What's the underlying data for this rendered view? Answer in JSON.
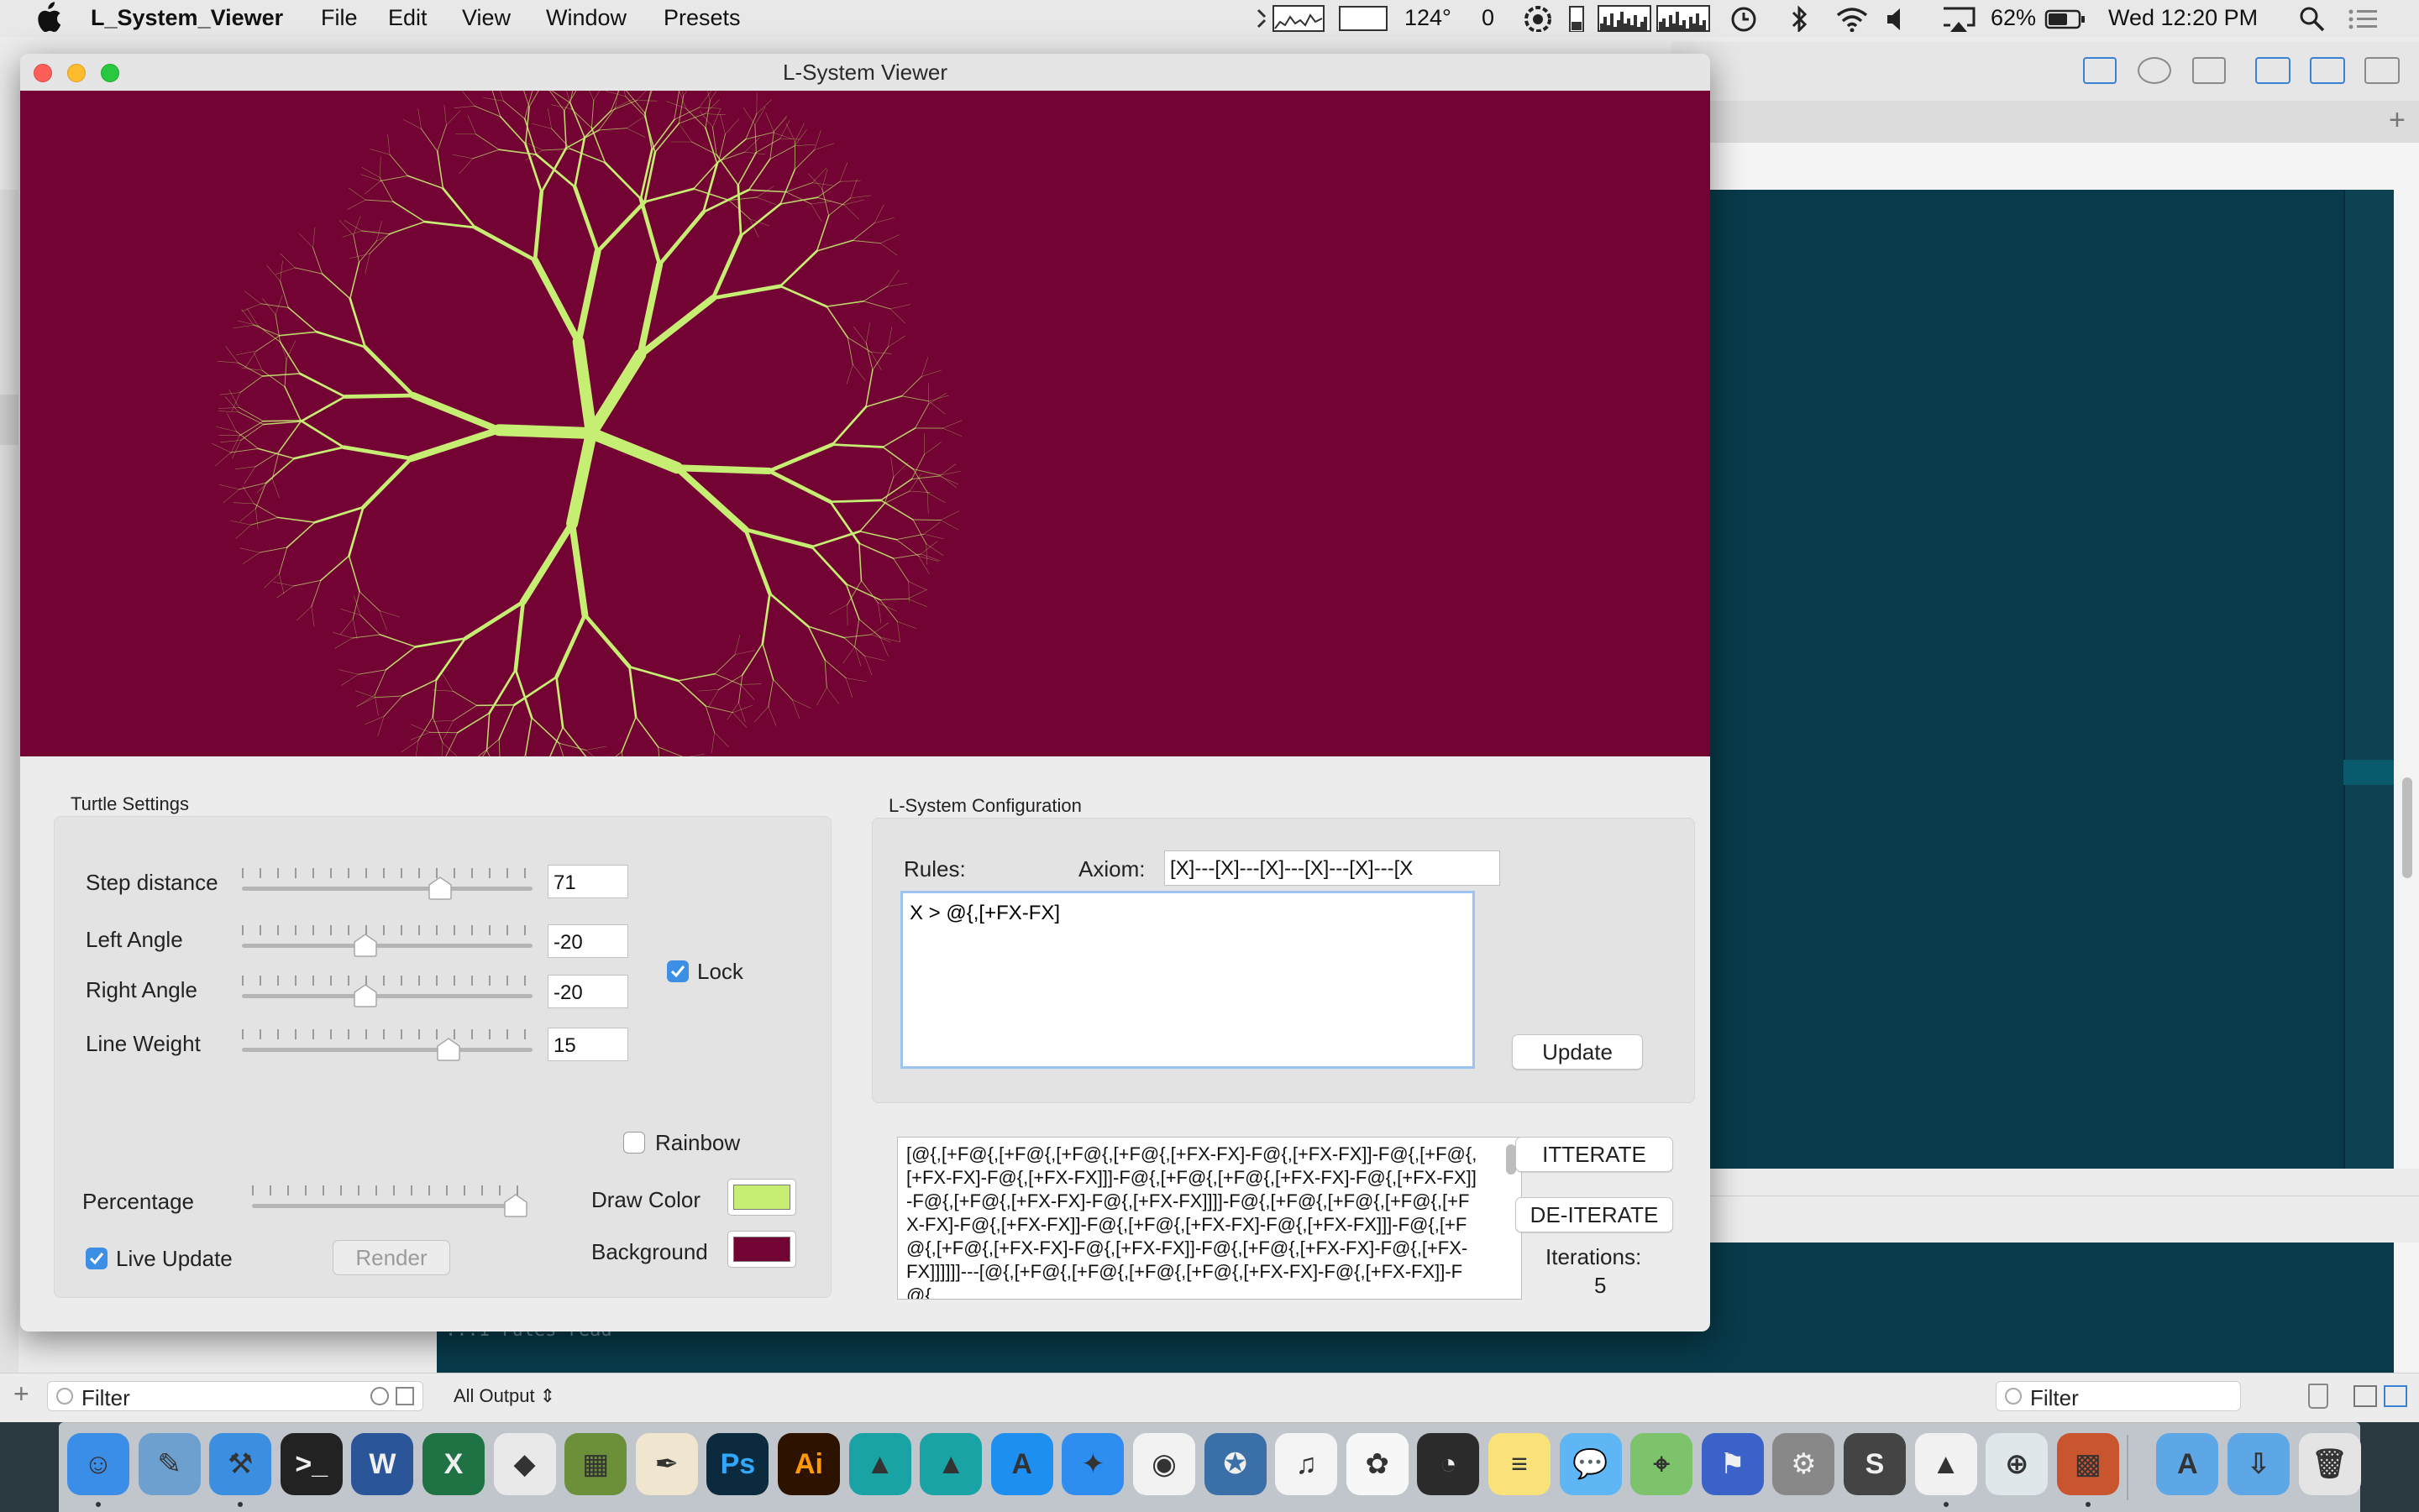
{
  "menubar": {
    "app_name": "L_System_Viewer",
    "menus": [
      "File",
      "Edit",
      "View",
      "Window",
      "Presets"
    ],
    "status": {
      "temperature": "124°",
      "counter": "0",
      "battery": "62%",
      "clock": "Wed 12:20 PM"
    }
  },
  "window": {
    "title": "L-System Viewer",
    "canvas_background": "#720333",
    "plant_color": "#c6ee72"
  },
  "turtle": {
    "group_title": "Turtle Settings",
    "step_label": "Step distance",
    "step_value": "71",
    "left_label": "Left Angle",
    "left_value": "-20",
    "right_label": "Right Angle",
    "right_value": "-20",
    "weight_label": "Line Weight",
    "weight_value": "15",
    "lock_label": "Lock",
    "lock_checked": true,
    "rainbow_label": "Rainbow",
    "rainbow_checked": false,
    "percentage_label": "Percentage",
    "draw_color_label": "Draw Color",
    "draw_color": "#c6ee72",
    "background_label": "Background",
    "background_color": "#720333",
    "live_update_label": "Live Update",
    "live_update_checked": true,
    "render_label": "Render",
    "sliders": {
      "step_fraction": 0.69,
      "left_fraction": 0.42,
      "right_fraction": 0.42,
      "weight_fraction": 0.72,
      "percentage_fraction": 1.0
    }
  },
  "lsystem": {
    "group_title": "L-System Configuration",
    "rules_label": "Rules:",
    "axiom_label": "Axiom:",
    "axiom_value": "[X]---[X]---[X]---[X]---[X]---[X",
    "rules_text": "X > @{,[+FX-FX]",
    "update_label": "Update",
    "output_text": "[@{,[+F@{,[+F@{,[+F@{,[+F@{,[+FX-FX]-F@{,[+FX-FX]]-F@{,[+F@{,[+FX-FX]-F@{,[+FX-FX]]]-F@{,[+F@{,[+F@{,[+FX-FX]-F@{,[+FX-FX]]-F@{,[+F@{,[+FX-FX]-F@{,[+FX-FX]]]]-F@{,[+F@{,[+F@{,[+F@{,[+FX-FX]-F@{,[+FX-FX]]-F@{,[+F@{,[+FX-FX]-F@{,[+FX-FX]]]-F@{,[+F@{,[+F@{,[+FX-FX]-F@{,[+FX-FX]]-F@{,[+F@{,[+FX-FX]-F@{,[+FX-FX]]]]]]---[@{,[+F@{,[+F@{,[+F@{,[+F@{,[+FX-FX]-F@{,[+FX-FX]]-F@{,",
    "iterate_label": "ITTERATE",
    "deiterate_label": "DE-ITERATE",
    "iterations_label": "Iterations:",
    "iterations_value": "5"
  },
  "xcode": {
    "console_text": "...1 rules read",
    "all_output_label": "All Output",
    "filter_placeholder_left": "Filter",
    "filter_placeholder_right": "Filter"
  },
  "dock": {
    "apps": [
      {
        "name": "Finder",
        "color": "#3a8ee8",
        "glyph": "☺"
      },
      {
        "name": "Preview",
        "color": "#6ea0cf",
        "glyph": "✎"
      },
      {
        "name": "Xcode",
        "color": "#3c8fe0",
        "glyph": "⚒"
      },
      {
        "name": "Terminal",
        "color": "#222222",
        "glyph": ">_"
      },
      {
        "name": "Word",
        "color": "#2a5699",
        "glyph": "W"
      },
      {
        "name": "Excel",
        "color": "#1f7244",
        "glyph": "X"
      },
      {
        "name": "Unity",
        "color": "#e9e9e9",
        "glyph": "◆"
      },
      {
        "name": "Minecraft",
        "color": "#6c8f3a",
        "glyph": "▦"
      },
      {
        "name": "Pen",
        "color": "#f0e6cf",
        "glyph": "✒"
      },
      {
        "name": "Photoshop",
        "color": "#0c2a3e",
        "glyph": "Ps"
      },
      {
        "name": "Illustrator",
        "color": "#2e1200",
        "glyph": "Ai"
      },
      {
        "name": "Maya",
        "color": "#19a3a5",
        "glyph": "▲"
      },
      {
        "name": "Mudbox",
        "color": "#19a3a5",
        "glyph": "▲"
      },
      {
        "name": "App Store",
        "color": "#1d8ff0",
        "glyph": "A"
      },
      {
        "name": "Safari",
        "color": "#2d8ef0",
        "glyph": "✦"
      },
      {
        "name": "Chrome",
        "color": "#f2f2f2",
        "glyph": "◉"
      },
      {
        "name": "Launchpad",
        "color": "#3a6fa8",
        "glyph": "✪"
      },
      {
        "name": "iTunes",
        "color": "#f4f4f4",
        "glyph": "♫"
      },
      {
        "name": "Photos",
        "color": "#f7f7f7",
        "glyph": "✿"
      },
      {
        "name": "Activity",
        "color": "#2b2b2b",
        "glyph": "◔"
      },
      {
        "name": "Notes",
        "color": "#f9e27a",
        "glyph": "≡"
      },
      {
        "name": "Messages",
        "color": "#5fb6f5",
        "glyph": "💬"
      },
      {
        "name": "Maps",
        "color": "#7cc36b",
        "glyph": "⌖"
      },
      {
        "name": "Instruments",
        "color": "#3a62c8",
        "glyph": "⚑"
      },
      {
        "name": "System Preferences",
        "color": "#888888",
        "glyph": "⚙"
      },
      {
        "name": "Sublime",
        "color": "#444444",
        "glyph": "S"
      },
      {
        "name": "VLC",
        "color": "#f1f1f1",
        "glyph": "▲"
      },
      {
        "name": "Network",
        "color": "#dfe7ea",
        "glyph": "⊕"
      },
      {
        "name": "Pattern",
        "color": "#c9552f",
        "glyph": "▩"
      },
      {
        "name": "Applications",
        "color": "#5ea7e6",
        "glyph": "A"
      },
      {
        "name": "Downloads",
        "color": "#5ea7e6",
        "glyph": "⇩"
      },
      {
        "name": "Trash",
        "color": "#e4e4e4",
        "glyph": "🗑"
      }
    ]
  }
}
